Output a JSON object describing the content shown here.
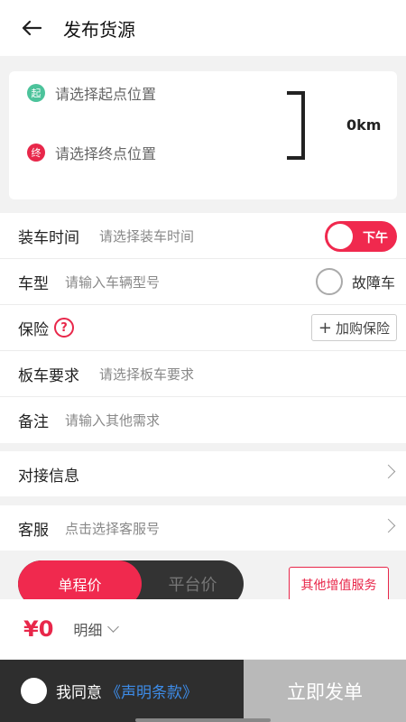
{
  "header": {
    "title": "发布货源",
    "back_icon": "arrow-left-icon"
  },
  "route": {
    "start_badge": "起",
    "start_placeholder": "请选择起点位置",
    "end_badge": "终",
    "end_placeholder": "请选择终点位置",
    "distance": "0km",
    "start_color": "#4cc39b",
    "end_color": "#e8274a"
  },
  "form": {
    "loading_time": {
      "label": "装车时间",
      "placeholder": "请选择装车时间",
      "toggle_text": "下午"
    },
    "vehicle_type": {
      "label": "车型",
      "placeholder": "请输入车辆型号",
      "fault_label": "故障车"
    },
    "insurance": {
      "label": "保险",
      "help": "?",
      "buy_label": "加购保险"
    },
    "trailer": {
      "label": "板车要求",
      "placeholder": "请选择板车要求"
    },
    "remark": {
      "label": "备注",
      "placeholder": "请输入其他需求"
    }
  },
  "docking": {
    "label": "对接信息"
  },
  "service": {
    "label": "客服",
    "placeholder": "点击选择客服号"
  },
  "pricing": {
    "tab_one_way": "单程价",
    "tab_platform": "平台价",
    "other_services": "其他增值服务"
  },
  "total": {
    "amount": "¥0",
    "detail": "明细"
  },
  "footer": {
    "agree_text": "我同意",
    "agree_link": "《声明条款》",
    "submit": "立即发单"
  },
  "colors": {
    "accent": "#f0294e",
    "link": "#3d8ce8",
    "dark": "#2e2e2e"
  }
}
